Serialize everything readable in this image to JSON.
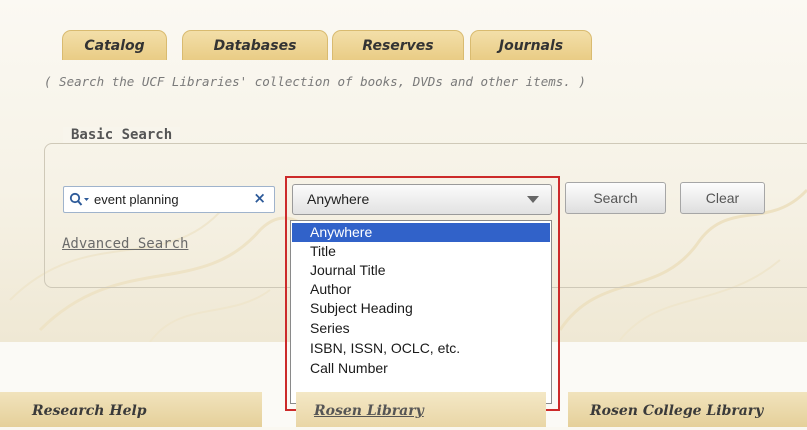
{
  "tabs": [
    {
      "label": "Catalog"
    },
    {
      "label": "Databases"
    },
    {
      "label": "Reserves"
    },
    {
      "label": "Journals"
    }
  ],
  "subtitle": "( Search the UCF Libraries' collection of books, DVDs and other items. )",
  "basic_search": {
    "legend": "Basic Search",
    "input_value": "event planning",
    "clear_symbol": "×",
    "advanced_link": "Advanced Search"
  },
  "search_field": {
    "selected": "Anywhere",
    "options": [
      "Anywhere",
      "Title",
      "Journal Title",
      "Author",
      "Subject Heading",
      "Series",
      "ISBN, ISSN, OCLC, etc.",
      "Call Number"
    ]
  },
  "buttons": {
    "search": "Search",
    "clear": "Clear"
  },
  "bottom_tabs": [
    {
      "label": "Research Help"
    },
    {
      "label": "Rosen Library"
    },
    {
      "label": "Rosen College Library"
    }
  ],
  "colors": {
    "selection": "#3162c9",
    "highlight_border": "#cc2a2a",
    "tab_bg": "#e9cc85"
  },
  "icons": {
    "search": "magnifier-dropdown-icon",
    "select_arrow": "triangle-down-icon",
    "clear": "x-icon"
  }
}
